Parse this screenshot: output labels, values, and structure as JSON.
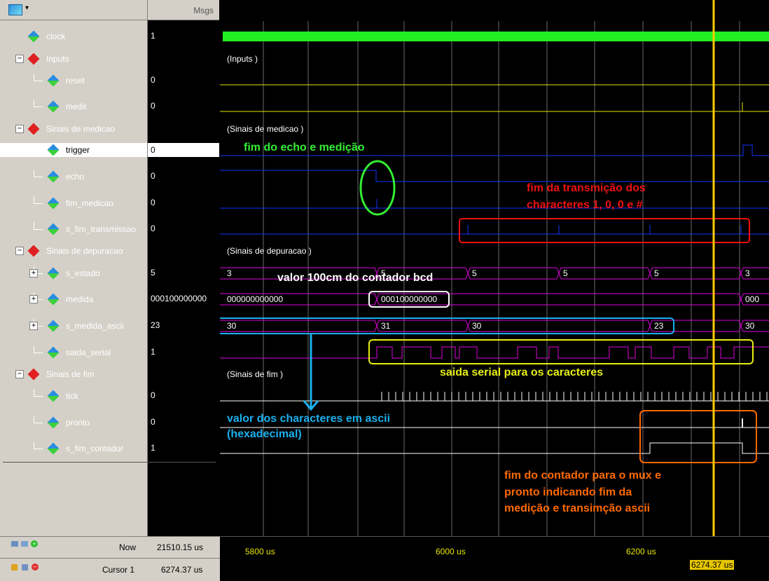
{
  "header": {
    "msgs_label": "Msgs"
  },
  "signals": [
    {
      "name": "clock",
      "value": "1",
      "type": "leaf"
    },
    {
      "name": "Inputs",
      "value": "",
      "type": "group"
    },
    {
      "name": "reset",
      "value": "0",
      "type": "child"
    },
    {
      "name": "medir",
      "value": "0",
      "type": "child"
    },
    {
      "name": "Sinais de medicao",
      "value": "",
      "type": "group"
    },
    {
      "name": "trigger",
      "value": "0",
      "type": "child"
    },
    {
      "name": "echo",
      "value": "0",
      "type": "child"
    },
    {
      "name": "fim_medicao",
      "value": "0",
      "type": "child"
    },
    {
      "name": "s_fim_transmissao",
      "value": "0",
      "type": "child"
    },
    {
      "name": "Sinais de depuracao",
      "value": "",
      "type": "group"
    },
    {
      "name": "s_estado",
      "value": "5",
      "type": "bus"
    },
    {
      "name": "medida",
      "value": "000100000000",
      "type": "bus"
    },
    {
      "name": "s_medida_ascii",
      "value": "23",
      "type": "bus"
    },
    {
      "name": "saida_serial",
      "value": "1",
      "type": "child"
    },
    {
      "name": "Sinais de fim",
      "value": "",
      "type": "group"
    },
    {
      "name": "tick",
      "value": "0",
      "type": "child"
    },
    {
      "name": "pronto",
      "value": "0",
      "type": "child"
    },
    {
      "name": "s_fim_contador",
      "value": "1",
      "type": "child"
    }
  ],
  "group_labels": {
    "inputs": "(Inputs )",
    "medicao": "(Sinais de medicao )",
    "depuracao": "(Sinais de depuracao )",
    "fim": "(Sinais de fim )"
  },
  "bus_values": {
    "s_estado": [
      "3",
      "5",
      "5",
      "5",
      "5",
      "3"
    ],
    "medida": [
      "000000000000",
      "000100000000",
      "000"
    ],
    "s_medida_ascii": [
      "30",
      "31",
      "30",
      "23",
      "30"
    ]
  },
  "status": {
    "now_label": "Now",
    "now_value": "21510.15 us",
    "cursor_label": "Cursor 1",
    "cursor_value": "6274.37 us",
    "cursor_tag": "6274.37 us"
  },
  "timeline": {
    "ticks": [
      "5800 us",
      "6000 us",
      "6200 us"
    ]
  },
  "annotations": {
    "echo": "fim do echo e medição",
    "transmissao_line1": "fim da transmição dos",
    "transmissao_line2": "characteres 1, 0, 0 e #",
    "bcd": "valor 100cm do contador bcd",
    "serial": "saida serial para os caracteres",
    "ascii_line1": "valor dos characteres em ascii",
    "ascii_line2": "(hexadecimal)",
    "contador_line1": "fim do contador para o mux e",
    "contador_line2": "pronto indicando fim da",
    "contador_line3": "medição e transimção ascii"
  },
  "colors": {
    "clock": "#22ee22",
    "input": "#e6e600",
    "medicao": "#1133ff",
    "bus": "#e000e0",
    "white": "#ffffff",
    "cursor": "#ffcc00",
    "green_note": "#33ee33",
    "red_note": "#ee1111",
    "blue_note": "#1ab0ee",
    "yellow_note": "#e6ee11",
    "orange_note": "#ff6a00"
  }
}
